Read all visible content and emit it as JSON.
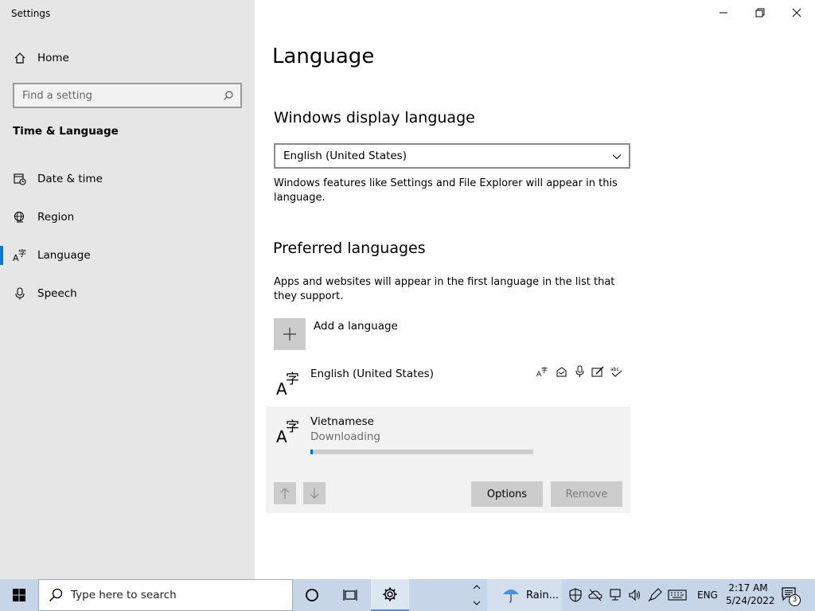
{
  "window": {
    "title": "Settings"
  },
  "sidebar": {
    "home_label": "Home",
    "search_placeholder": "Find a setting",
    "section_title": "Time & Language",
    "items": [
      {
        "label": "Date & time",
        "icon": "calendar-clock-icon"
      },
      {
        "label": "Region",
        "icon": "globe-icon"
      },
      {
        "label": "Language",
        "icon": "language-icon",
        "selected": true
      },
      {
        "label": "Speech",
        "icon": "microphone-icon"
      }
    ]
  },
  "main": {
    "title": "Language",
    "display_language": {
      "heading": "Windows display language",
      "selected": "English (United States)",
      "description": "Windows features like Settings and File Explorer will appear in this language."
    },
    "preferred": {
      "heading": "Preferred languages",
      "description": "Apps and websites will appear in the first language in the list that they support.",
      "add_label": "Add a language",
      "languages": [
        {
          "name": "English (United States)",
          "status": ""
        },
        {
          "name": "Vietnamese",
          "status": "Downloading",
          "progress": 0.01
        }
      ],
      "options_label": "Options",
      "remove_label": "Remove"
    }
  },
  "taskbar": {
    "search_placeholder": "Type here to search",
    "weather": "Rain...",
    "lang": "ENG",
    "time": "2:17 AM",
    "date": "5/24/2022",
    "notifications": "3"
  },
  "colors": {
    "accent": "#0078d7",
    "sidebar_bg": "#e6e6e6",
    "taskbar_bg": "#c6d6e8"
  }
}
